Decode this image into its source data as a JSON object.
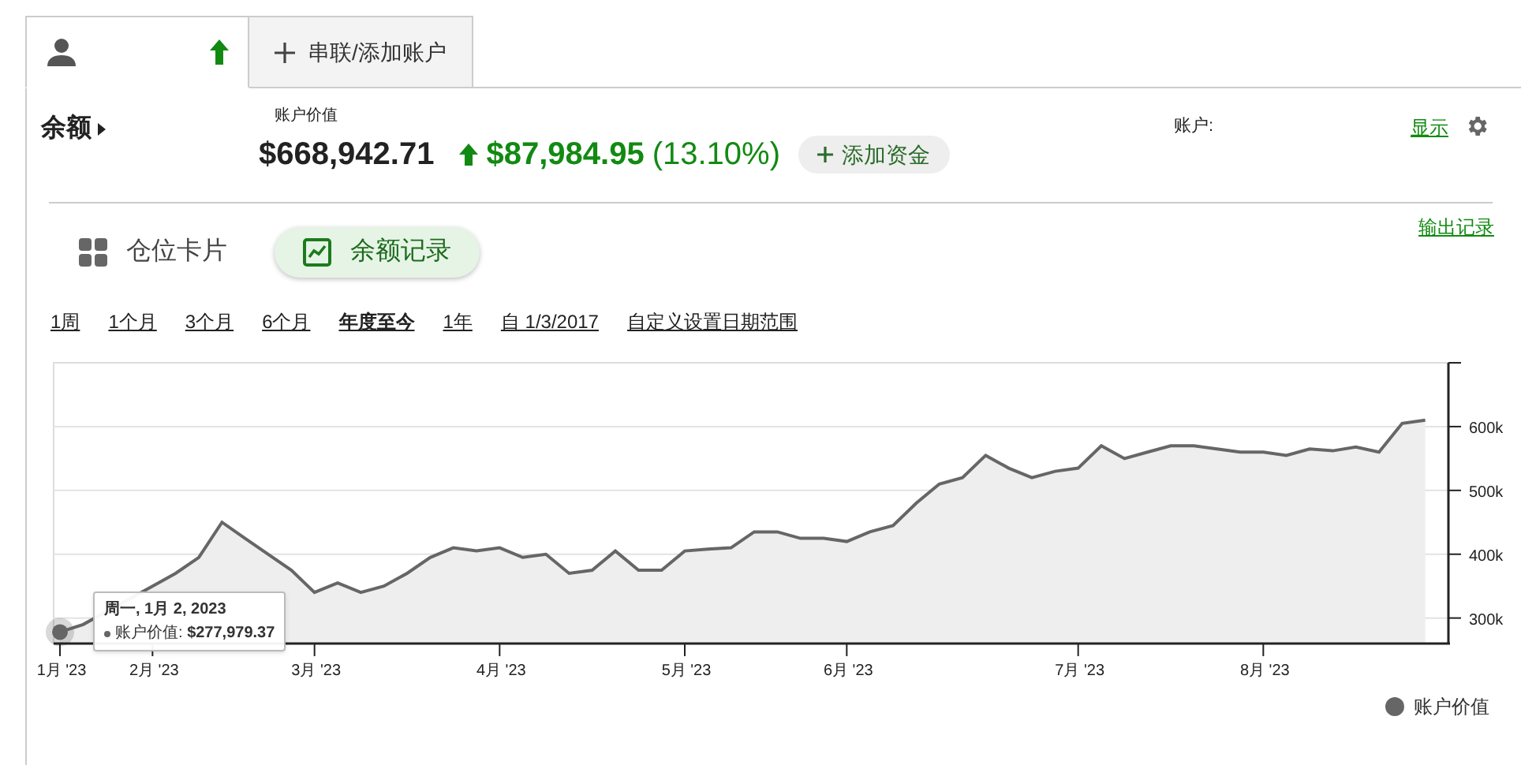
{
  "account_tabs": [
    {
      "kind": "account",
      "selected": true
    },
    {
      "kind": "add",
      "label": "串联/添加账户",
      "selected": false
    }
  ],
  "header": {
    "title": "余额",
    "value_label": "账户价值",
    "value": "$668,942.71",
    "change": "$87,984.95",
    "change_pct": "(13.10%)",
    "add_funds": "添加资金",
    "account_label": "账户:",
    "show_link": "显示"
  },
  "views": [
    {
      "kind": "cards",
      "label": "仓位卡片",
      "selected": false
    },
    {
      "kind": "history",
      "label": "余额记录",
      "selected": true
    }
  ],
  "export_link": "输出记录",
  "ranges": [
    {
      "label": "1周",
      "selected": false
    },
    {
      "label": "1个月",
      "selected": false
    },
    {
      "label": "3个月",
      "selected": false
    },
    {
      "label": "6个月",
      "selected": false
    },
    {
      "label": "年度至今",
      "selected": true
    },
    {
      "label": "1年",
      "selected": false
    },
    {
      "label": "自 1/3/2017",
      "selected": false
    },
    {
      "label": "自定义设置日期范围",
      "selected": false
    }
  ],
  "chart_data": {
    "type": "area",
    "grid": true,
    "ylim": [
      260000,
      700000
    ],
    "categories": [
      "1月 '23",
      null,
      null,
      null,
      "2月 '23",
      null,
      null,
      null,
      null,
      null,
      null,
      "3月 '23",
      null,
      null,
      null,
      null,
      null,
      null,
      null,
      "4月 '23",
      null,
      null,
      null,
      null,
      null,
      null,
      null,
      "5月 '23",
      null,
      null,
      null,
      null,
      null,
      null,
      "6月 '23",
      null,
      null,
      null,
      null,
      null,
      null,
      null,
      null,
      null,
      "7月 '23",
      null,
      null,
      null,
      null,
      null,
      null,
      null,
      "8月 '23",
      null,
      null,
      null,
      null,
      null,
      null,
      null
    ],
    "yticks": [
      {
        "value": 300000,
        "label": "300k"
      },
      {
        "value": 400000,
        "label": "400k"
      },
      {
        "value": 500000,
        "label": "500k"
      },
      {
        "value": 600000,
        "label": "600k"
      }
    ],
    "series": [
      {
        "name": "账户价值",
        "color": "#666666",
        "values": [
          278000,
          290000,
          null,
          null,
          350000,
          370000,
          395000,
          450000,
          425000,
          400000,
          375000,
          340000,
          355000,
          340000,
          350000,
          370000,
          395000,
          410000,
          405000,
          410000,
          395000,
          400000,
          370000,
          375000,
          405000,
          375000,
          375000,
          405000,
          408000,
          410000,
          435000,
          435000,
          425000,
          425000,
          420000,
          435000,
          445000,
          480000,
          510000,
          520000,
          555000,
          535000,
          520000,
          530000,
          535000,
          570000,
          550000,
          560000,
          570000,
          570000,
          565000,
          560000,
          560000,
          555000,
          565000,
          562000,
          568000,
          560000,
          605000,
          610000
        ]
      }
    ]
  },
  "tooltip": {
    "title": "周一, 1月 2, 2023",
    "value": "账户价值: **$277,979.37**"
  }
}
